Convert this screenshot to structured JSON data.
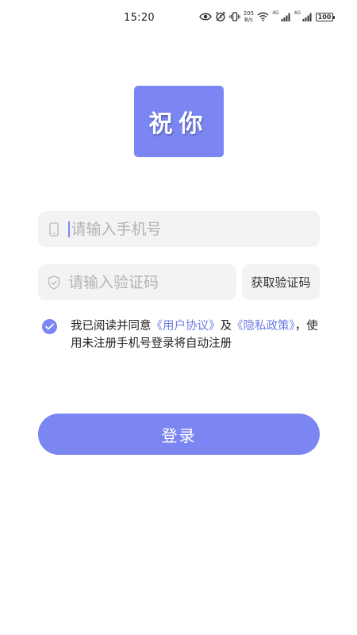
{
  "status_bar": {
    "time": "15:20",
    "net_speed_value": "205",
    "net_speed_unit": "B/s",
    "network_type_1": "4G",
    "network_type_2": "4G",
    "battery": "100",
    "icons": [
      "eye-icon",
      "alarm-icon",
      "vibrate-icon",
      "wifi-icon",
      "signal-icon",
      "signal-icon",
      "battery-icon"
    ]
  },
  "logo": {
    "text": "祝你",
    "color": "#7b86f2"
  },
  "login_form": {
    "phone": {
      "placeholder": "请输入手机号",
      "value": "",
      "icon": "phone-icon"
    },
    "code": {
      "placeholder": "请输入验证码",
      "value": "",
      "icon": "shield-icon"
    },
    "get_code_label": "获取验证码"
  },
  "agreement": {
    "checked": true,
    "prefix": "我已阅读并同意",
    "user_agreement": "《用户协议》",
    "conjunction": "及",
    "privacy_policy": "《隐私政策》",
    "suffix": "，使用未注册手机号登录将自动注册"
  },
  "login_button": {
    "label": "登录",
    "color": "#7b86f2"
  },
  "colors": {
    "accent": "#7b86f2",
    "link": "#6c7be5",
    "field_bg": "#f3f3f3",
    "placeholder": "#b3b3b3"
  }
}
